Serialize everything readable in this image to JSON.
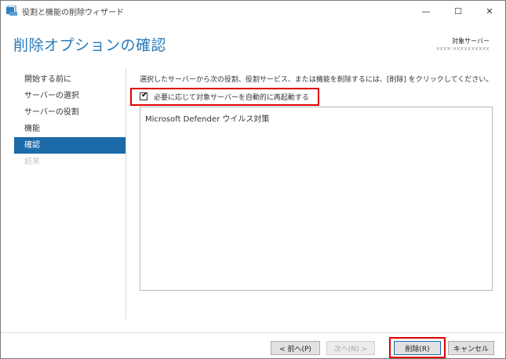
{
  "window": {
    "title": "役割と機能の削除ウィザード",
    "controls": {
      "minimize": "—",
      "maximize": "☐",
      "close": "✕"
    }
  },
  "header": {
    "title": "削除オプションの確認",
    "target_label": "対象サーバー",
    "target_value": "xxxx-xxxxxxxxxx"
  },
  "nav": {
    "items": [
      {
        "label": "開始する前に"
      },
      {
        "label": "サーバーの選択"
      },
      {
        "label": "サーバーの役割"
      },
      {
        "label": "機能"
      },
      {
        "label": "確認"
      },
      {
        "label": "結果"
      }
    ]
  },
  "main": {
    "description": "選択したサーバーから次の役割、役割サービス、または機能を削除するには、[削除] をクリックしてください。",
    "restart_checkbox": {
      "label": "必要に応じて対象サーバーを自動的に再起動する",
      "checked": true,
      "mark": "✔"
    },
    "list_items": [
      "Microsoft Defender ウイルス対策"
    ]
  },
  "footer": {
    "prev_label": "< 前へ(P)",
    "next_label": "次へ(N) >",
    "delete_label": "削除(R)",
    "cancel_label": "キャンセル"
  },
  "colors": {
    "accent": "#1c6aa8",
    "title": "#2a7ab8",
    "highlight": "#e00000"
  }
}
